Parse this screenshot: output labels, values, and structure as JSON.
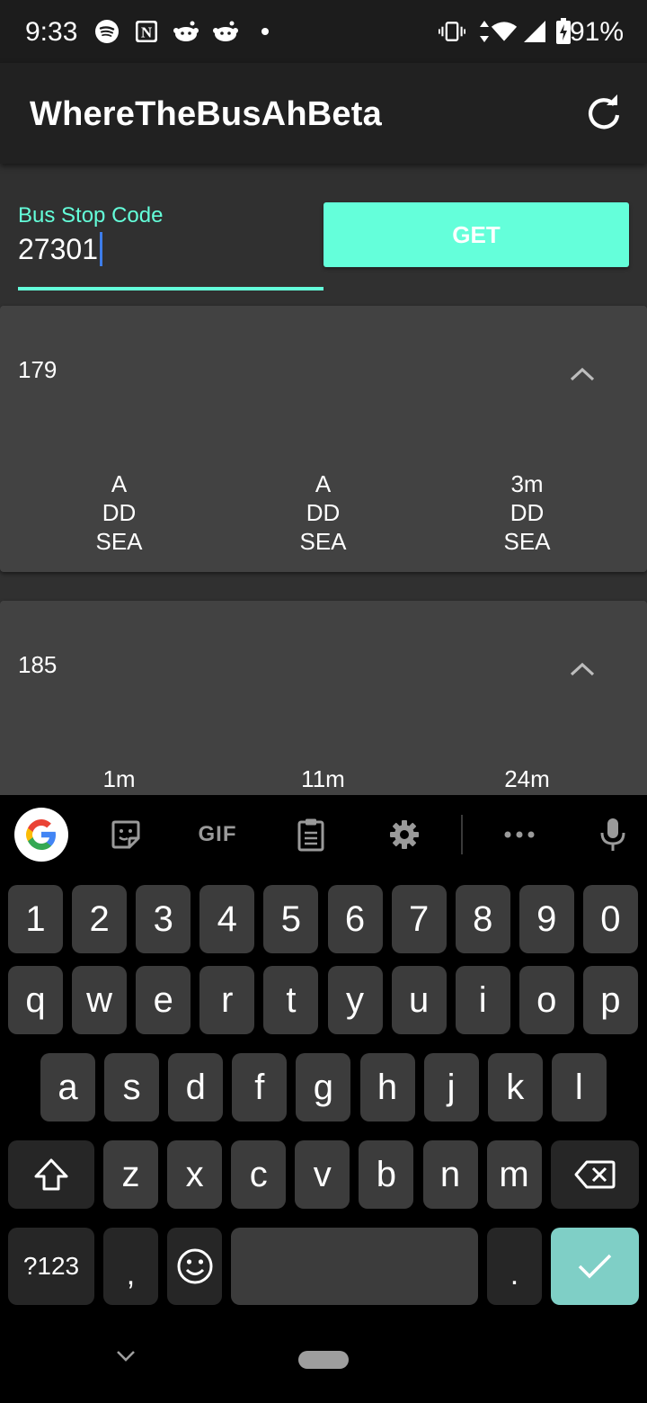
{
  "status_bar": {
    "time": "9:33",
    "battery": "91%",
    "left_icons": [
      "spotify-icon",
      "notion-icon",
      "reddit-icon",
      "reddit-icon",
      "dot-icon"
    ],
    "right_icons": [
      "vibrate-icon",
      "data-arrows-icon",
      "wifi-icon",
      "signal-icon",
      "battery-charging-icon"
    ]
  },
  "app_bar": {
    "title": "WhereTheBusAhBeta",
    "refresh_icon": "refresh-icon"
  },
  "search": {
    "label": "Bus Stop Code",
    "value": "27301",
    "button_label": "GET"
  },
  "colors": {
    "accent": "#64ffda",
    "background": "#303030",
    "card": "#424242",
    "appbar": "#212121"
  },
  "services": [
    {
      "route": "179",
      "arrivals": [
        {
          "time": "A",
          "type": "DD",
          "load": "SEA"
        },
        {
          "time": "A",
          "type": "DD",
          "load": "SEA"
        },
        {
          "time": "3m",
          "type": "DD",
          "load": "SEA"
        }
      ]
    },
    {
      "route": "185",
      "arrivals": [
        {
          "time": "1m"
        },
        {
          "time": "11m"
        },
        {
          "time": "24m"
        }
      ]
    }
  ],
  "keyboard": {
    "toolbar": [
      "google-icon",
      "sticker-icon",
      "GIF",
      "clipboard-icon",
      "settings-icon",
      "more-icon",
      "mic-icon"
    ],
    "row_numbers": [
      "1",
      "2",
      "3",
      "4",
      "5",
      "6",
      "7",
      "8",
      "9",
      "0"
    ],
    "row_1": [
      "q",
      "w",
      "e",
      "r",
      "t",
      "y",
      "u",
      "i",
      "o",
      "p"
    ],
    "row_2": [
      "a",
      "s",
      "d",
      "f",
      "g",
      "h",
      "j",
      "k",
      "l"
    ],
    "row_3": [
      "z",
      "x",
      "c",
      "v",
      "b",
      "n",
      "m"
    ],
    "symbols_label": "?123",
    "comma": ",",
    "period": "."
  }
}
